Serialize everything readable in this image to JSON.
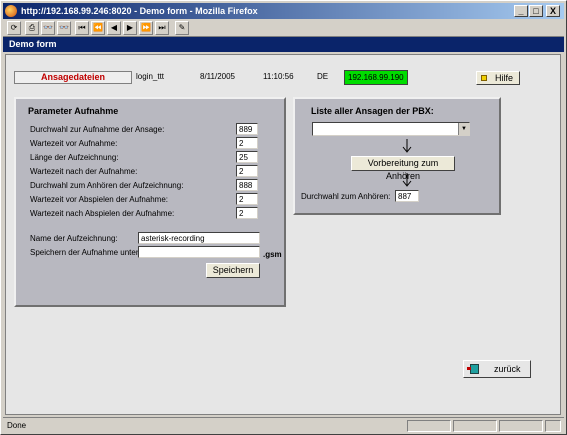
{
  "window": {
    "title": "http://192.168.99.246:8020 - Demo form - Mozilla Firefox",
    "minimize": "_",
    "maximize": "□",
    "close": "X"
  },
  "toolbar": {
    "icons": [
      "reload-icon",
      "print-icon",
      "binoculars-icon",
      "binoculars-icon",
      "first-icon",
      "rewind-icon",
      "prev-icon",
      "next-icon",
      "fast-forward-icon",
      "last-icon",
      "edit-icon"
    ],
    "glyphs": [
      "⟳",
      "⎙",
      "👓",
      "👓",
      "⏮",
      "⏪",
      "◀",
      "▶",
      "⏩",
      "⏭",
      "✎"
    ]
  },
  "app": {
    "title": "Demo form"
  },
  "header": {
    "files_button": "Ansagedateien",
    "user": "login_ttt",
    "date": "8/11/2005",
    "time": "11:10:56",
    "lang": "DE",
    "ip": "192.168.99.190",
    "help_button": "Hilfe"
  },
  "params": {
    "title": "Parameter Aufnahme",
    "rows": [
      {
        "label": "Durchwahl zur Aufnahme der Ansage:",
        "value": "889"
      },
      {
        "label": "Wartezeit vor Aufnahme:",
        "value": "2"
      },
      {
        "label": "Länge der Aufzeichnung:",
        "value": "25"
      },
      {
        "label": "Wartezeit nach der Aufnahme:",
        "value": "2"
      },
      {
        "label": "Durchwahl zum Anhören der Aufzeichnung:",
        "value": "888"
      },
      {
        "label": "Wartezeit vor Abspielen der Aufnahme:",
        "value": "2"
      },
      {
        "label": "Wartezeit nach Abspielen der Aufnahme:",
        "value": "2"
      }
    ],
    "name_label": "Name der Aufzeichnung:",
    "name_value": "asterisk-recording",
    "save_label": "Speichern der Aufnahme unter:",
    "save_value": "",
    "save_ext": ".gsm",
    "save_button": "Speichern"
  },
  "list": {
    "title": "Liste aller Ansagen der PBX:",
    "select_value": "",
    "prepare_button": "Vorbereitung zum Anhören",
    "dial_label": "Durchwahl zum Anhören:",
    "dial_value": "887"
  },
  "back_button": "zurück",
  "status": {
    "text": "Done"
  }
}
